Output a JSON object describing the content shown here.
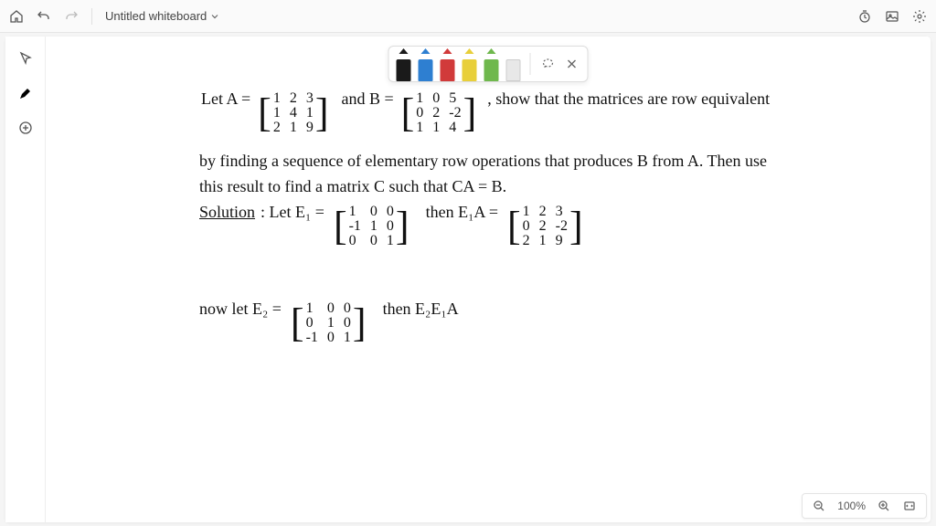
{
  "titlebar": {
    "doc_title": "Untitled whiteboard"
  },
  "pens": {
    "colors": [
      "#1a1a1a",
      "#2e7fd1",
      "#d13a3a",
      "#e8cf3a",
      "#6fb84d",
      "#e8e8e8"
    ]
  },
  "zoom": {
    "level": "100%"
  },
  "content": {
    "letA": "Let A =",
    "andB": "and B =",
    "show": ", show that the matrices are row equivalent",
    "line2": "by finding a sequence of elementary row operations that produces B from A. Then use",
    "line3": "this result to find a matrix C such that CA = B.",
    "solution": "Solution",
    "letE1": ": Let E₁ =",
    "thenE1A": "then E₁A =",
    "nowE2": "now let E₂ =",
    "thenE2E1A": "then E₂E₁A",
    "matA": [
      "1",
      "2",
      "3",
      "1",
      "4",
      "1",
      "2",
      "1",
      "9"
    ],
    "matB": [
      "1",
      "0",
      "5",
      "0",
      "2",
      "-2",
      "1",
      "1",
      "4"
    ],
    "matE1": [
      "1",
      "0",
      "0",
      "-1",
      "1",
      "0",
      "0",
      "0",
      "1"
    ],
    "matE1A": [
      "1",
      "2",
      "3",
      "0",
      "2",
      "-2",
      "2",
      "1",
      "9"
    ],
    "matE2": [
      "1",
      "0",
      "0",
      "0",
      "1",
      "0",
      "-1",
      "0",
      "1"
    ]
  }
}
